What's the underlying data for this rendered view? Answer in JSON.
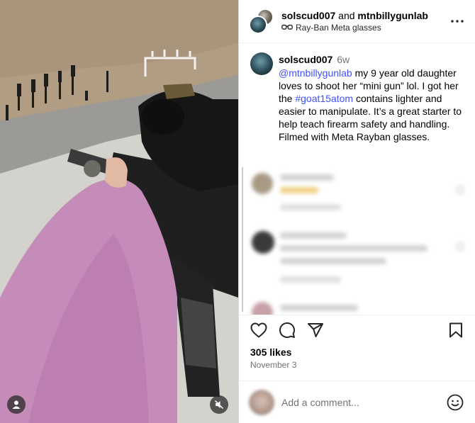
{
  "post": {
    "author": "solscud007",
    "collaborator": "mtnbillygunlab",
    "conjunction": "and",
    "subtitle": "Ray-Ban Meta glasses",
    "subtitle_icon": "glasses-icon"
  },
  "caption": {
    "username": "solscud007",
    "time": "6w",
    "mention": "@mtnbillygunlab",
    "text_part1": " my 9 year old daughter loves to shoot her “mini gun” lol. I got her the ",
    "hashtag": "#goat15atom",
    "text_part2": " contains lighter and easier to manipulate. It’s a great starter to help teach firearm safety and handling. Filmed with Meta Rayban glasses."
  },
  "stats": {
    "likes": "305 likes",
    "date": "November 3"
  },
  "comment_box": {
    "placeholder": "Add a comment..."
  },
  "icons": {
    "more": "more-options-icon",
    "like": "heart-icon",
    "comment": "comment-icon",
    "share": "share-icon",
    "save": "bookmark-icon",
    "emoji": "emoji-icon",
    "user_tag": "user-icon",
    "mute": "mute-icon"
  },
  "colors": {
    "link": "#4150f7",
    "muted_text": "#737373",
    "border": "#dbdbdb"
  }
}
